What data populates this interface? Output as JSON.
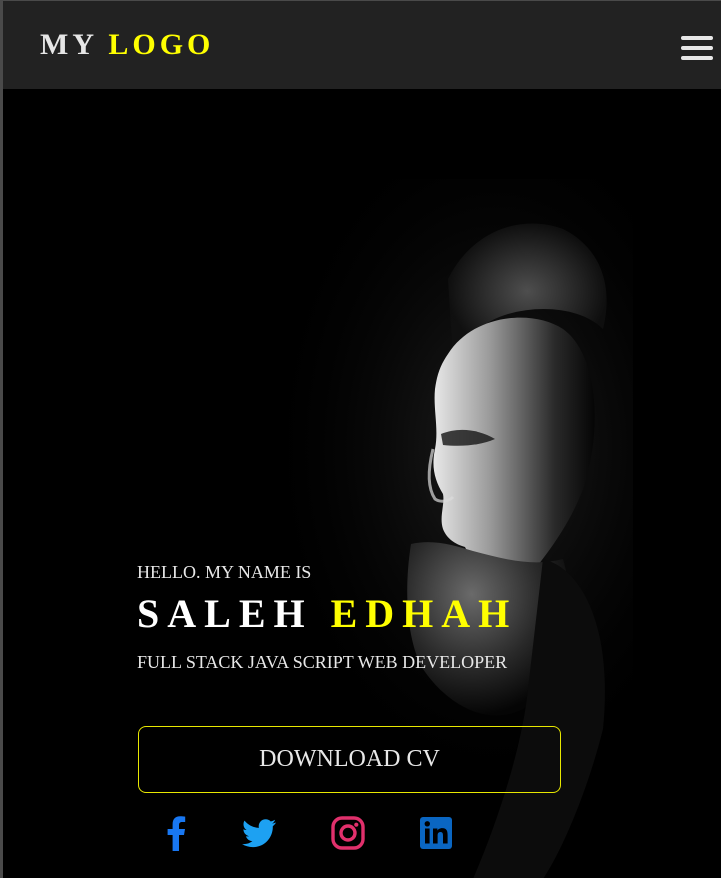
{
  "header": {
    "logo_part1": "MY",
    "logo_part2": "LOGO",
    "menu_icon": "hamburger-menu-icon"
  },
  "hero": {
    "greeting": "HELLO. MY NAME IS",
    "first_name": "SALEH",
    "last_name": "EDHAH",
    "role": "FULL STACK JAVA SCRIPT WEB DEVELOPER",
    "cv_button": "DOWNLOAD CV"
  },
  "social": [
    {
      "icon": "facebook-icon",
      "color": "#1877f2"
    },
    {
      "icon": "twitter-icon",
      "color": "#1da1f2"
    },
    {
      "icon": "instagram-icon",
      "color": "#e1306c"
    },
    {
      "icon": "linkedin-icon",
      "color": "#0a66c2"
    }
  ],
  "colors": {
    "accent": "#ffff00",
    "navbar": "#222222",
    "background": "#000000",
    "text": "#e8e8e8"
  }
}
